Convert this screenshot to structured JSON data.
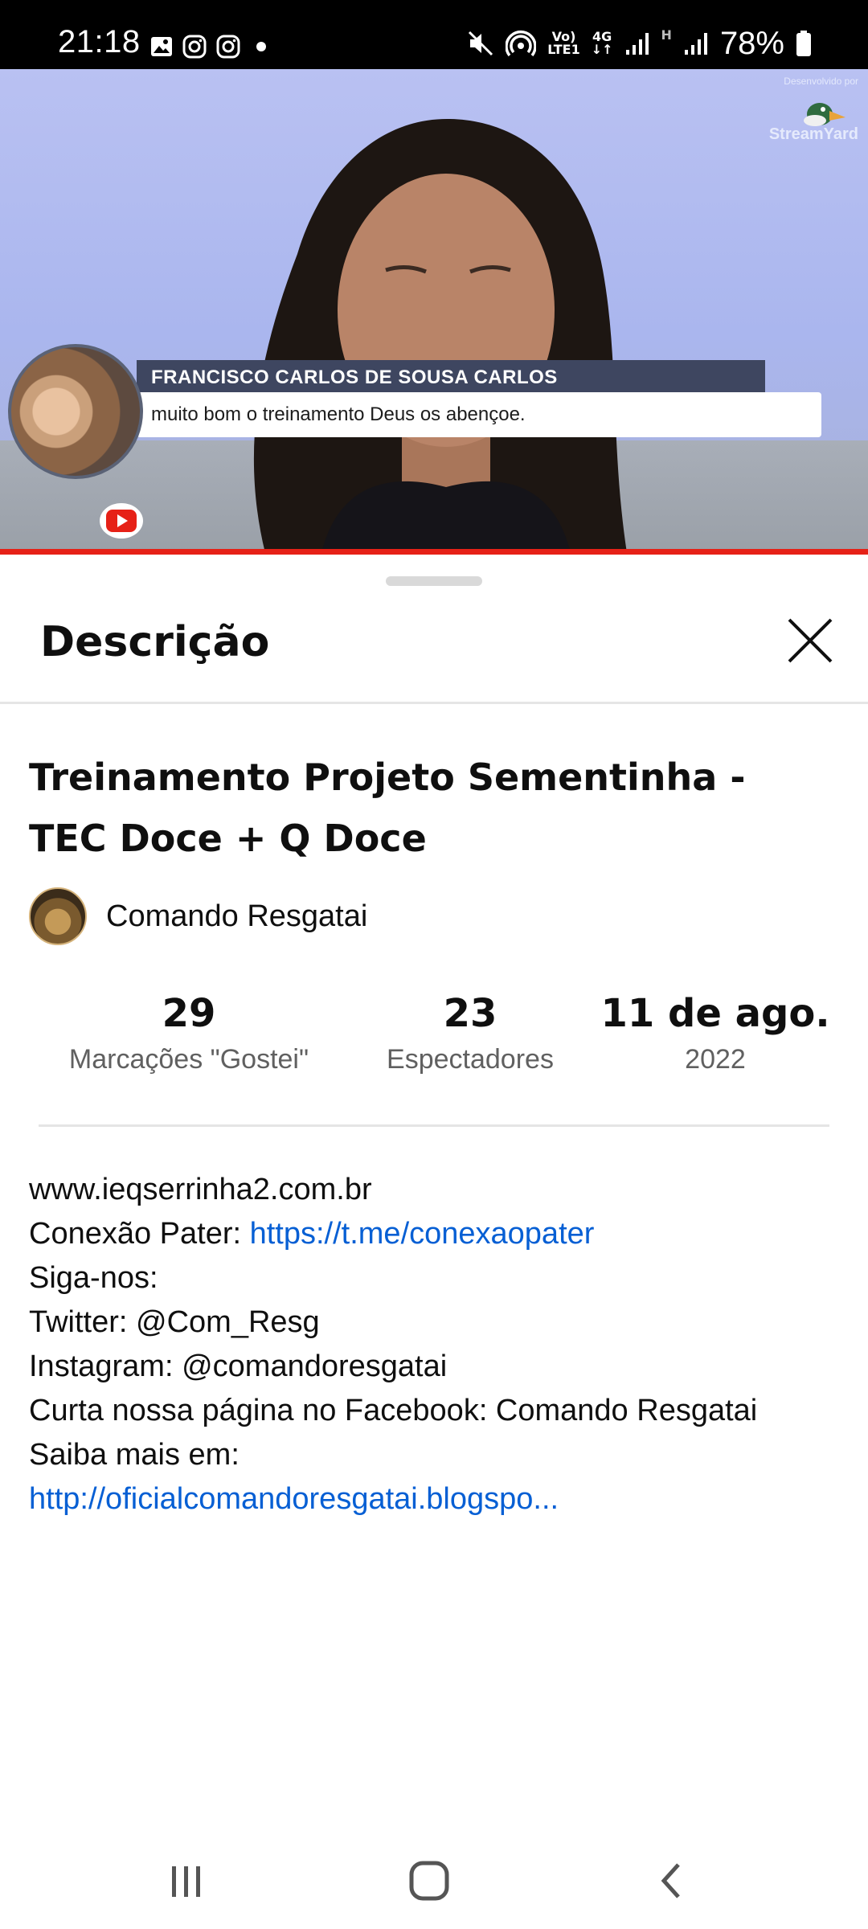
{
  "status_bar": {
    "time": "21:18",
    "battery": "78%",
    "net_top": "Vo)",
    "net_bottom": "LTE1",
    "gen": "4G",
    "h": "H",
    "icons": [
      "image-icon",
      "instagram-icon",
      "instagram-icon",
      "dot-icon",
      "mute-icon",
      "hotspot-icon",
      "signal-icon",
      "signal-icon",
      "battery-icon"
    ]
  },
  "video": {
    "overlay_name": "FRANCISCO CARLOS DE SOUSA CARLOS",
    "overlay_message": "muito bom o treinamento Deus os abençoe.",
    "watermark_caption": "Desenvolvido por",
    "watermark_name": "StreamYard",
    "progress_fraction": 1.0
  },
  "sheet": {
    "title": "Descrição",
    "close_icon": "close-icon"
  },
  "video_info": {
    "title": "Treinamento Projeto Sementinha - TEC Doce + Q Doce",
    "channel_name": "Comando Resgatai"
  },
  "stats": {
    "likes_value": "29",
    "likes_label": "Marcações \"Gostei\"",
    "viewers_value": "23",
    "viewers_label": "Espectadores",
    "date_value": "11 de ago.",
    "date_year": "2022"
  },
  "description": {
    "line1": "www.ieqserrinha2.com.br",
    "line2_prefix": "Conexão Pater: ",
    "line2_link": "https://t.me/conexaopater",
    "line3": "Siga-nos:",
    "line4": "Twitter: @Com_Resg",
    "line5": "Instagram: @comandoresgatai",
    "line6": "Curta nossa página no Facebook: Comando Resgatai",
    "line7": "Saiba mais em:",
    "line8_link": "http://oficialcomandoresgatai.blogspo..."
  },
  "colors": {
    "link": "#065fd4",
    "progress": "#e62117",
    "secondary_text": "#606060"
  }
}
